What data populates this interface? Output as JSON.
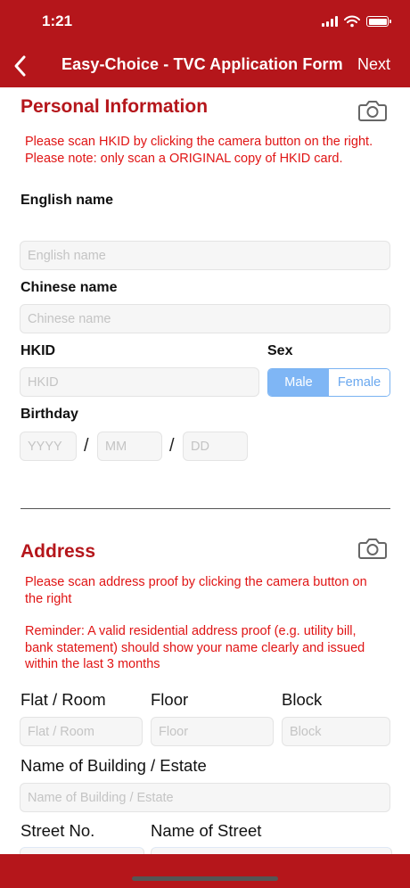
{
  "status_bar": {
    "time": "1:21"
  },
  "nav": {
    "title": "Easy-Choice - TVC Application Form",
    "next": "Next"
  },
  "personal": {
    "title": "Personal Information",
    "note": "Please scan HKID by clicking the camera button on the right. Please note: only scan a ORIGINAL copy of HKID card.",
    "english_name_label": "English name",
    "english_name_placeholder": "English name",
    "chinese_name_label": "Chinese name",
    "chinese_name_placeholder": "Chinese name",
    "hkid_label": "HKID",
    "hkid_placeholder": "HKID",
    "sex_label": "Sex",
    "sex_options": [
      "Male",
      "Female"
    ],
    "sex_selected": "Male",
    "birthday_label": "Birthday",
    "birthday_placeholders": {
      "year": "YYYY",
      "month": "MM",
      "day": "DD"
    },
    "separator": "/"
  },
  "address": {
    "title": "Address",
    "note": "Please scan address proof by clicking the camera button on the right",
    "reminder": "Reminder: A valid residential address proof (e.g. utility bill, bank statement) should show your name clearly and issued within the last 3 months",
    "flat_label": "Flat / Room",
    "flat_placeholder": "Flat / Room",
    "floor_label": "Floor",
    "floor_placeholder": "Floor",
    "block_label": "Block",
    "block_placeholder": "Block",
    "building_label": "Name of Building / Estate",
    "building_placeholder": "Name of Building / Estate",
    "street_no_label": "Street No.",
    "street_name_label": "Name of Street"
  },
  "colors": {
    "brand": "#b5161b",
    "note": "#e01414",
    "segment": "#7fb6f5"
  },
  "icons": {
    "back": "chevron-left-icon",
    "camera": "camera-icon"
  }
}
